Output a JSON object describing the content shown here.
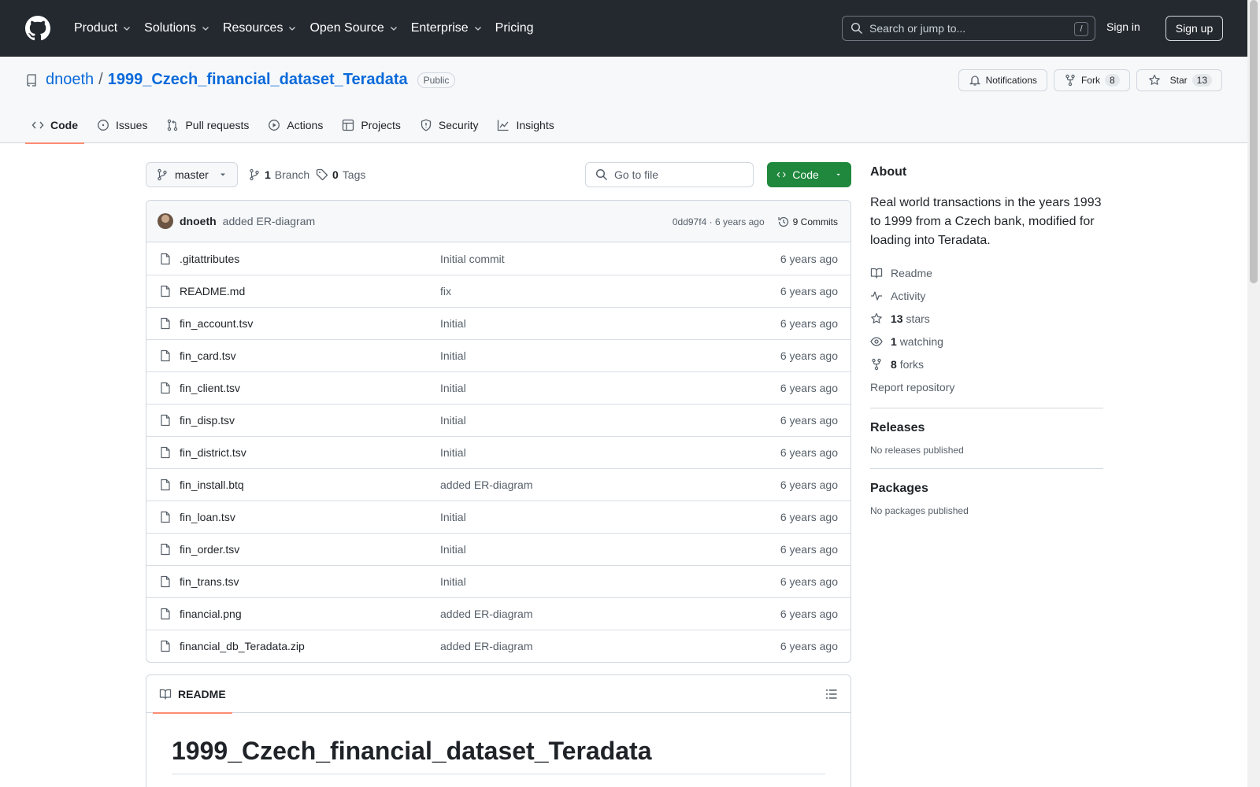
{
  "header": {
    "nav": [
      {
        "label": "Product",
        "dropdown": true
      },
      {
        "label": "Solutions",
        "dropdown": true
      },
      {
        "label": "Resources",
        "dropdown": true
      },
      {
        "label": "Open Source",
        "dropdown": true
      },
      {
        "label": "Enterprise",
        "dropdown": true
      },
      {
        "label": "Pricing",
        "dropdown": false
      }
    ],
    "search_placeholder": "Search or jump to...",
    "search_shortcut": "/",
    "sign_in": "Sign in",
    "sign_up": "Sign up"
  },
  "repo": {
    "owner": "dnoeth",
    "separator": "/",
    "name": "1999_Czech_financial_dataset_Teradata",
    "visibility": "Public",
    "notifications_label": "Notifications",
    "fork_label": "Fork",
    "fork_count": "8",
    "star_label": "Star",
    "star_count": "13",
    "tabs": [
      {
        "label": "Code",
        "icon": "code-icon",
        "active": true
      },
      {
        "label": "Issues",
        "icon": "issue-icon",
        "active": false
      },
      {
        "label": "Pull requests",
        "icon": "pull-request-icon",
        "active": false
      },
      {
        "label": "Actions",
        "icon": "play-icon",
        "active": false
      },
      {
        "label": "Projects",
        "icon": "table-icon",
        "active": false
      },
      {
        "label": "Security",
        "icon": "shield-icon",
        "active": false
      },
      {
        "label": "Insights",
        "icon": "graph-icon",
        "active": false
      }
    ]
  },
  "toolbar": {
    "branch": "master",
    "branch_count": "1",
    "branch_label": "Branch",
    "tag_count": "0",
    "tag_label": "Tags",
    "goto_placeholder": "Go to file",
    "code_button": "Code"
  },
  "commit": {
    "author": "dnoeth",
    "message": "added ER-diagram",
    "sha": "0dd97f4",
    "dot": "·",
    "age": "6 years ago",
    "commits_label": "9 Commits"
  },
  "files": [
    {
      "name": ".gitattributes",
      "message": "Initial commit",
      "age": "6 years ago"
    },
    {
      "name": "README.md",
      "message": "fix",
      "age": "6 years ago"
    },
    {
      "name": "fin_account.tsv",
      "message": "Initial",
      "age": "6 years ago"
    },
    {
      "name": "fin_card.tsv",
      "message": "Initial",
      "age": "6 years ago"
    },
    {
      "name": "fin_client.tsv",
      "message": "Initial",
      "age": "6 years ago"
    },
    {
      "name": "fin_disp.tsv",
      "message": "Initial",
      "age": "6 years ago"
    },
    {
      "name": "fin_district.tsv",
      "message": "Initial",
      "age": "6 years ago"
    },
    {
      "name": "fin_install.btq",
      "message": "added ER-diagram",
      "age": "6 years ago"
    },
    {
      "name": "fin_loan.tsv",
      "message": "Initial",
      "age": "6 years ago"
    },
    {
      "name": "fin_order.tsv",
      "message": "Initial",
      "age": "6 years ago"
    },
    {
      "name": "fin_trans.tsv",
      "message": "Initial",
      "age": "6 years ago"
    },
    {
      "name": "financial.png",
      "message": "added ER-diagram",
      "age": "6 years ago"
    },
    {
      "name": "financial_db_Teradata.zip",
      "message": "added ER-diagram",
      "age": "6 years ago"
    }
  ],
  "readme": {
    "tab_label": "README",
    "heading": "1999_Czech_financial_dataset_Teradata"
  },
  "about": {
    "title": "About",
    "description": "Real world transactions in the years 1993 to 1999 from a Czech bank, modified for loading into Teradata.",
    "readme": "Readme",
    "activity": "Activity",
    "stars_count": "13",
    "stars_label": "stars",
    "watching_count": "1",
    "watching_label": "watching",
    "forks_count": "8",
    "forks_label": "forks",
    "report": "Report repository"
  },
  "releases": {
    "title": "Releases",
    "empty": "No releases published"
  },
  "packages": {
    "title": "Packages",
    "empty": "No packages published"
  }
}
